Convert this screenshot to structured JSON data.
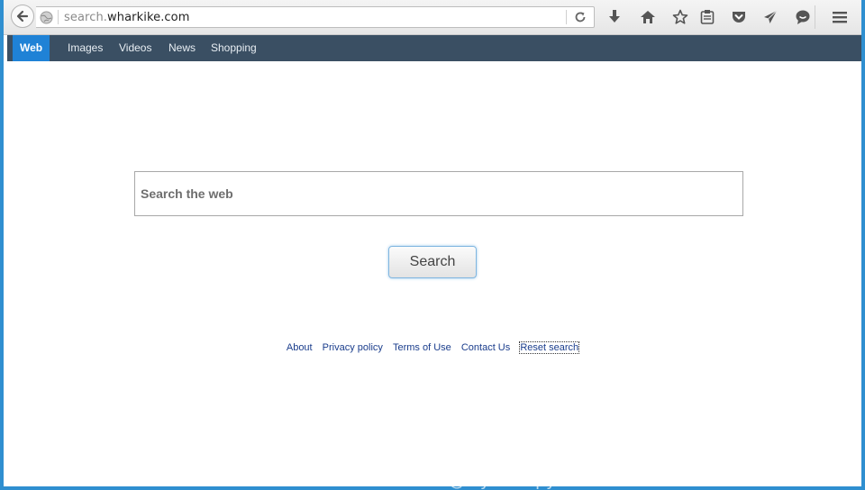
{
  "browser": {
    "url_prefix": "search.",
    "url_domain": "wharkike.com",
    "icons": [
      "back-icon",
      "globe-icon",
      "reload-icon",
      "download-icon",
      "home-icon",
      "bookmark-star-icon",
      "reading-list-icon",
      "pocket-icon",
      "send-icon",
      "chat-icon",
      "menu-icon"
    ]
  },
  "nav": {
    "items": [
      {
        "label": "Web",
        "active": true
      },
      {
        "label": "Images"
      },
      {
        "label": "Videos"
      },
      {
        "label": "News"
      },
      {
        "label": "Shopping"
      }
    ]
  },
  "search": {
    "placeholder": "Search the web",
    "button_label": "Search"
  },
  "footer": {
    "links": [
      "About",
      "Privacy policy",
      "Terms of Use",
      "Contact Us",
      "Reset search"
    ]
  },
  "watermark": "search.wharkike.com@MyAntiSpyware",
  "colors": {
    "nav_bg": "#3a4f63",
    "nav_active": "#1f82d6",
    "frame": "#2f8fd0",
    "link": "#1a3d8c"
  }
}
